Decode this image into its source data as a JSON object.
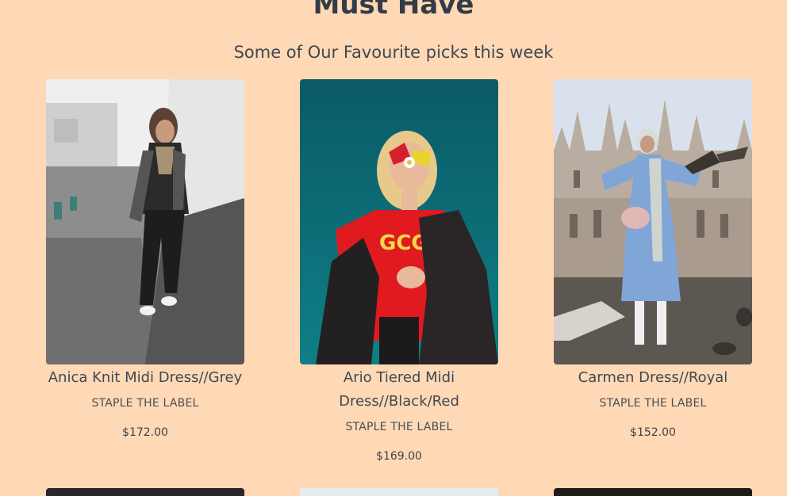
{
  "section": {
    "title": "Must Have",
    "subtitle": "Some of Our Favourite picks this week"
  },
  "products": [
    {
      "name": "Anica Knit Midi Dress//Grey",
      "brand": "STAPLE THE LABEL",
      "price": "$172.00"
    },
    {
      "name": "Ario Tiered Midi Dress//Black/Red",
      "brand": "STAPLE THE LABEL",
      "price": "$169.00"
    },
    {
      "name": "Carmen Dress//Royal",
      "brand": "STAPLE THE LABEL",
      "price": "$152.00"
    }
  ],
  "colors": {
    "background": "#FFD9B5",
    "text": "#3b4450"
  }
}
